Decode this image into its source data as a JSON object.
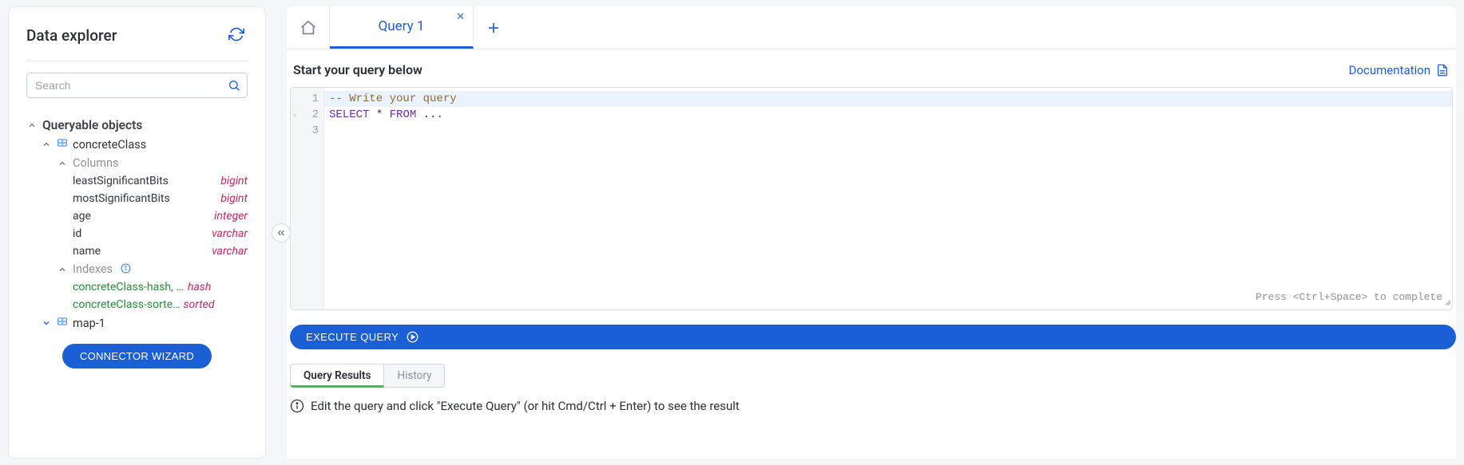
{
  "sidebar": {
    "title": "Data explorer",
    "search_placeholder": "Search",
    "queryable_label": "Queryable objects",
    "objects": [
      {
        "name": "concreteClass",
        "expanded": true,
        "columns_label": "Columns",
        "columns": [
          {
            "name": "leastSignificantBits",
            "type": "bigint"
          },
          {
            "name": "mostSignificantBits",
            "type": "bigint"
          },
          {
            "name": "age",
            "type": "integer"
          },
          {
            "name": "id",
            "type": "varchar"
          },
          {
            "name": "name",
            "type": "varchar"
          }
        ],
        "indexes_label": "Indexes",
        "indexes": [
          {
            "name": "concreteClass-hash, n…",
            "type": "hash"
          },
          {
            "name": "concreteClass-sorte…",
            "type": "sorted"
          }
        ]
      },
      {
        "name": "map-1",
        "expanded": false
      }
    ],
    "connector_button": "CONNECTOR WIZARD"
  },
  "tabs": {
    "items": [
      {
        "label": "Query 1",
        "active": true
      }
    ]
  },
  "query": {
    "header": "Start your query below",
    "doc_link": "Documentation",
    "lines": {
      "l1": "-- Write your query",
      "l2a": "SELECT",
      "l2b": " * ",
      "l2c": "FROM",
      "l2d": " ..."
    },
    "gutter": [
      "1",
      "2",
      "3"
    ],
    "hint": "Press <Ctrl+Space> to complete",
    "execute_label": "EXECUTE QUERY"
  },
  "results": {
    "tabs": [
      {
        "label": "Query Results",
        "active": true
      },
      {
        "label": "History",
        "active": false
      }
    ],
    "hint": "Edit the query and click \"Execute Query\" (or hit Cmd/Ctrl + Enter) to see the result"
  }
}
